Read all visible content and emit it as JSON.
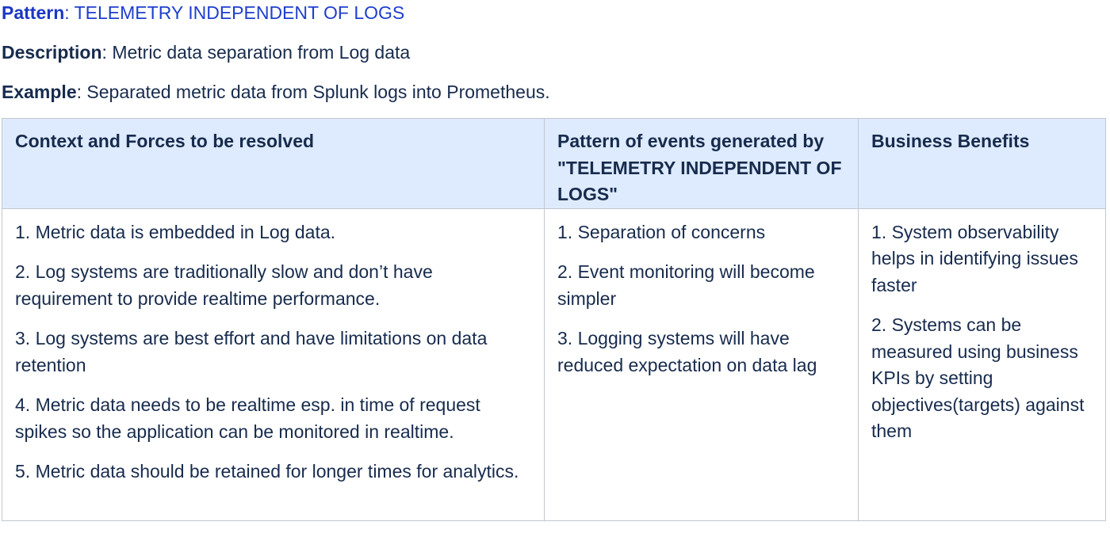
{
  "pattern": {
    "label": "Pattern",
    "separator": ": ",
    "value": "TELEMETRY INDEPENDENT OF LOGS"
  },
  "description": {
    "label": "Description",
    "separator": ": ",
    "value": "Metric data separation from Log data"
  },
  "example": {
    "label": "Example",
    "separator": ": ",
    "value": "Separated metric data from Splunk logs into Prometheus."
  },
  "table": {
    "headers": [
      "Context and Forces to be resolved",
      "Pattern of events generated by \"TELEMETRY INDEPENDENT OF LOGS\"",
      "Business Benefits"
    ],
    "columns": [
      [
        "1. Metric data is embedded in Log data.",
        "2. Log systems are traditionally slow and don’t have requirement to provide realtime performance.",
        "3. Log systems are best effort and have limitations on data retention",
        "4. Metric data needs to be realtime esp. in time of request spikes so the application can be monitored in realtime.",
        "5. Metric data should be retained for longer times for analytics."
      ],
      [
        "1. Separation of concerns",
        "2. Event monitoring will become simpler",
        "3. Logging systems will have reduced expectation on data lag"
      ],
      [
        "1. System observability helps in identifying issues faster",
        "2. Systems can be measured using business KPIs by setting objectives(targets) against them"
      ]
    ]
  },
  "colors": {
    "text": "#172b4d",
    "pattern_text": "#1f3fce",
    "header_bg": "#deebff",
    "border": "#c1c7d0"
  }
}
